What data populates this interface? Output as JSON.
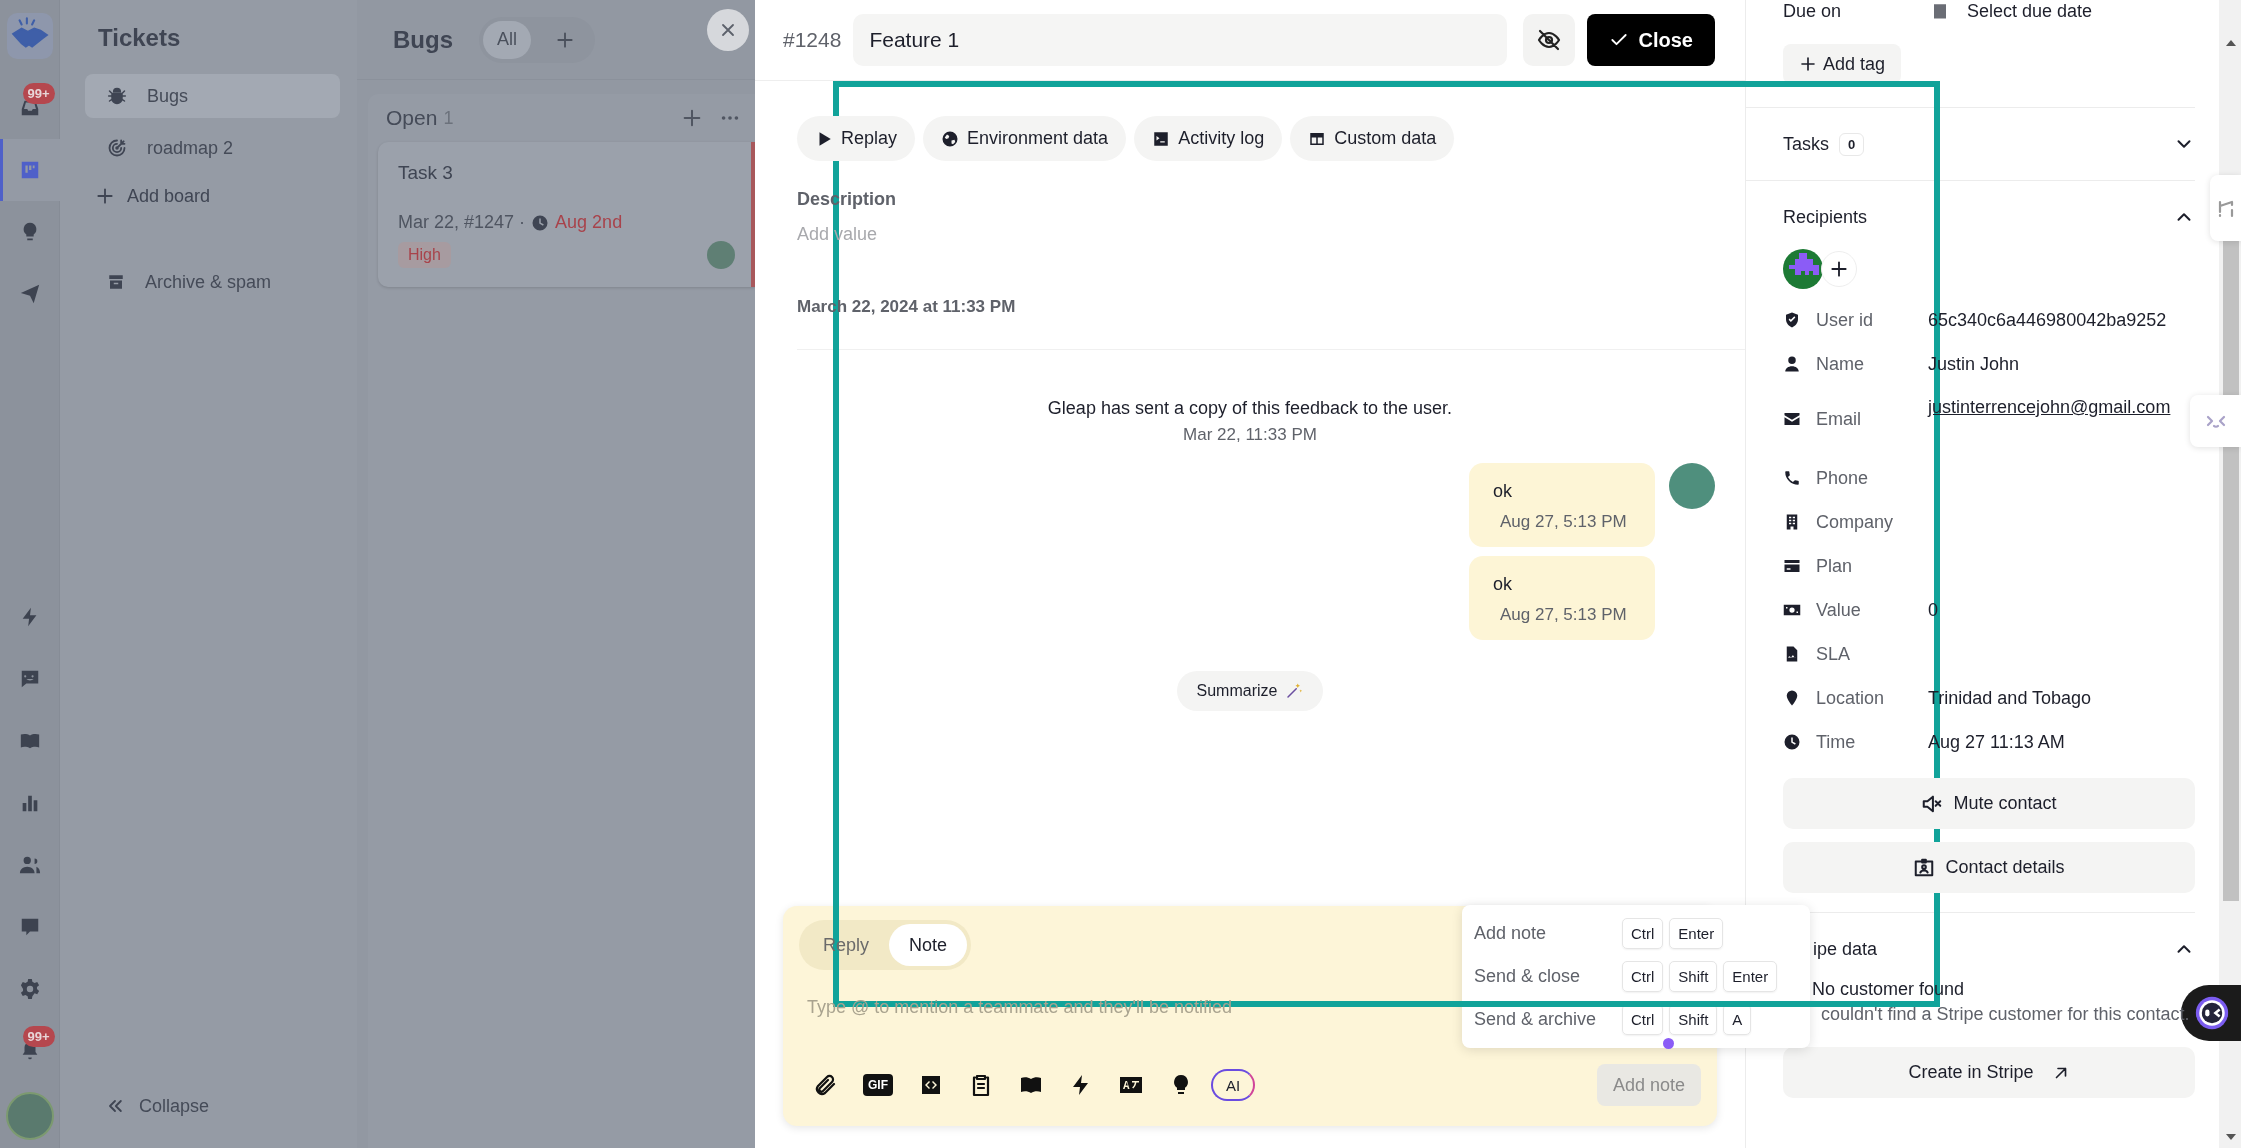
{
  "nav_rail": {
    "top": [
      {
        "selected": false,
        "badge": "99+"
      },
      {
        "selected": true
      },
      {
        "selected": false
      },
      {
        "selected": false
      }
    ],
    "bottom": [
      {
        "selected": false
      },
      {
        "selected": false
      },
      {
        "selected": false
      },
      {
        "selected": false
      },
      {
        "selected": false
      },
      {
        "selected": false
      },
      {
        "selected": false
      },
      {
        "selected": false,
        "badge": "99+"
      }
    ]
  },
  "tickets_panel": {
    "title": "Tickets",
    "boards": [
      {
        "label": "Bugs",
        "selected": true
      },
      {
        "label": "roadmap 2",
        "selected": false
      }
    ],
    "add_board": "Add board",
    "archive": "Archive & spam",
    "collapse": "Collapse"
  },
  "board": {
    "title": "Bugs",
    "filters": [
      {
        "label": "All",
        "selected": true
      }
    ],
    "columns": [
      {
        "title": "Open",
        "count": "1",
        "cards": [
          {
            "title": "Task 3",
            "meta": "Mar 22, #1247 ·",
            "due": "Aug 2nd",
            "priority": "High"
          }
        ]
      }
    ]
  },
  "ticket": {
    "number": "#1248",
    "title": "Feature 1",
    "close_label": "Close",
    "chips": [
      "Replay",
      "Environment data",
      "Activity log",
      "Custom data"
    ],
    "description_label": "Description",
    "description_placeholder": "Add value",
    "created": "March 22, 2024 at 11:33 PM"
  },
  "conversation": {
    "messages": [
      {
        "kind": "system",
        "text": "Gleap has sent a copy of this feedback to the user.",
        "time": "Mar 22, 11:33 PM"
      },
      {
        "kind": "user",
        "text": "ok",
        "time": "Aug 27, 5:13 PM",
        "avatar": true
      },
      {
        "kind": "user",
        "text": "ok",
        "time": "Aug 27, 5:13 PM",
        "avatar": false
      }
    ],
    "summarize": "Summarize"
  },
  "composer": {
    "modes": [
      {
        "label": "Reply",
        "selected": false
      },
      {
        "label": "Note",
        "selected": true
      }
    ],
    "placeholder": "Type @ to mention a teammate and they'll be notified",
    "tools": [
      {
        "kind": "attach"
      },
      {
        "kind": "gif",
        "label": "GIF"
      },
      {
        "kind": "code"
      },
      {
        "kind": "clipboard"
      },
      {
        "kind": "book"
      },
      {
        "kind": "bolt"
      },
      {
        "kind": "translate"
      },
      {
        "kind": "bulb"
      },
      {
        "kind": "ai",
        "label": "AI"
      }
    ],
    "submit": {
      "label": "Add note",
      "disabled": true
    },
    "shortcuts": [
      {
        "action": "Add note",
        "keys": [
          "Ctrl",
          "Enter"
        ]
      },
      {
        "action": "Send & close",
        "keys": [
          "Ctrl",
          "Shift",
          "Enter"
        ]
      },
      {
        "action": "Send & archive",
        "keys": [
          "Ctrl",
          "Shift",
          "A"
        ]
      }
    ]
  },
  "details": {
    "due_label": "Due on",
    "due_value": "Select due date",
    "add_tag": "Add tag",
    "tasks": {
      "title": "Tasks",
      "count": "0",
      "expanded": false
    },
    "recipients": {
      "title": "Recipients",
      "expanded": true,
      "fields": [
        {
          "label": "User id",
          "value": "65c340c6a446980042ba9252"
        },
        {
          "label": "Name",
          "value": "Justin John"
        },
        {
          "label": "Email",
          "value": "justinterrencejohn@gmail.com",
          "link": true
        },
        {
          "label": "Phone"
        },
        {
          "label": "Company"
        },
        {
          "label": "Plan"
        },
        {
          "label": "Value",
          "value": "0"
        },
        {
          "label": "SLA"
        },
        {
          "label": "Location",
          "value": "Trinidad and Tobago"
        },
        {
          "label": "Time",
          "value": "Aug 27 11:13 AM"
        }
      ],
      "actions": [
        "Mute contact",
        "Contact details"
      ]
    },
    "stripe": {
      "title": "ipe data",
      "expanded": true,
      "status": "No customer found",
      "message": "couldn't find a Stripe customer for this contact.",
      "action": "Create in Stripe"
    }
  }
}
